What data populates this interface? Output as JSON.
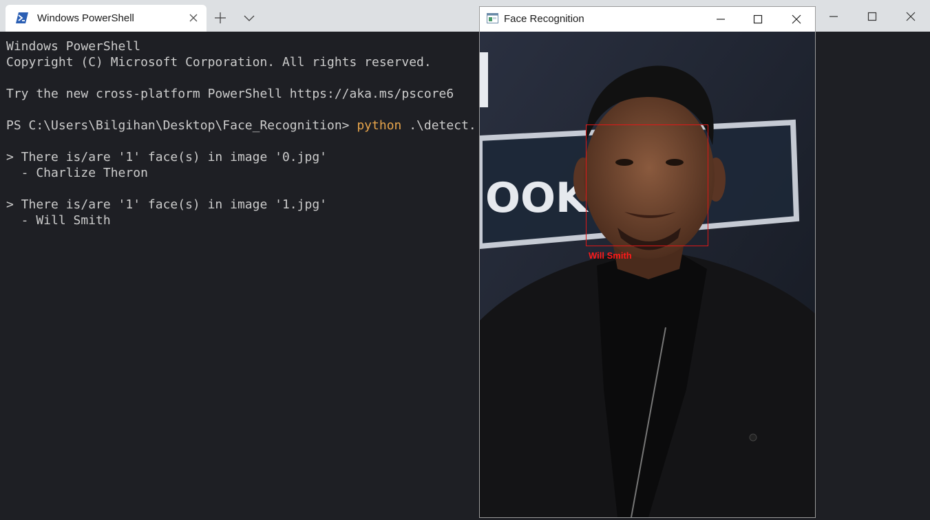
{
  "terminal": {
    "tab_title": "Windows PowerShell",
    "tab_icon": "powershell-icon",
    "lines": [
      "Windows PowerShell",
      "Copyright (C) Microsoft Corporation. All rights reserved.",
      "",
      "Try the new cross-platform PowerShell https://aka.ms/pscore6",
      ""
    ],
    "prompt": "PS C:\\Users\\Bilgihan\\Desktop\\Face_Recognition> ",
    "command_keyword": "python",
    "command_args": " .\\detect.",
    "output": [
      "> There is/are '1' face(s) in image '0.jpg'",
      "  - Charlize Theron",
      "",
      "> There is/are '1' face(s) in image '1.jpg'",
      "  - Will Smith"
    ],
    "colors": {
      "background": "#1e1f24",
      "text": "#cccccc",
      "command_highlight": "#e8a54b",
      "titlebar": "#dde0e3"
    }
  },
  "face_window": {
    "title": "Face Recognition",
    "app_icon": "opencv-window-icon",
    "detection_label": "Will Smith",
    "box_color": "#e01818",
    "background_text": "OOKE 13"
  }
}
